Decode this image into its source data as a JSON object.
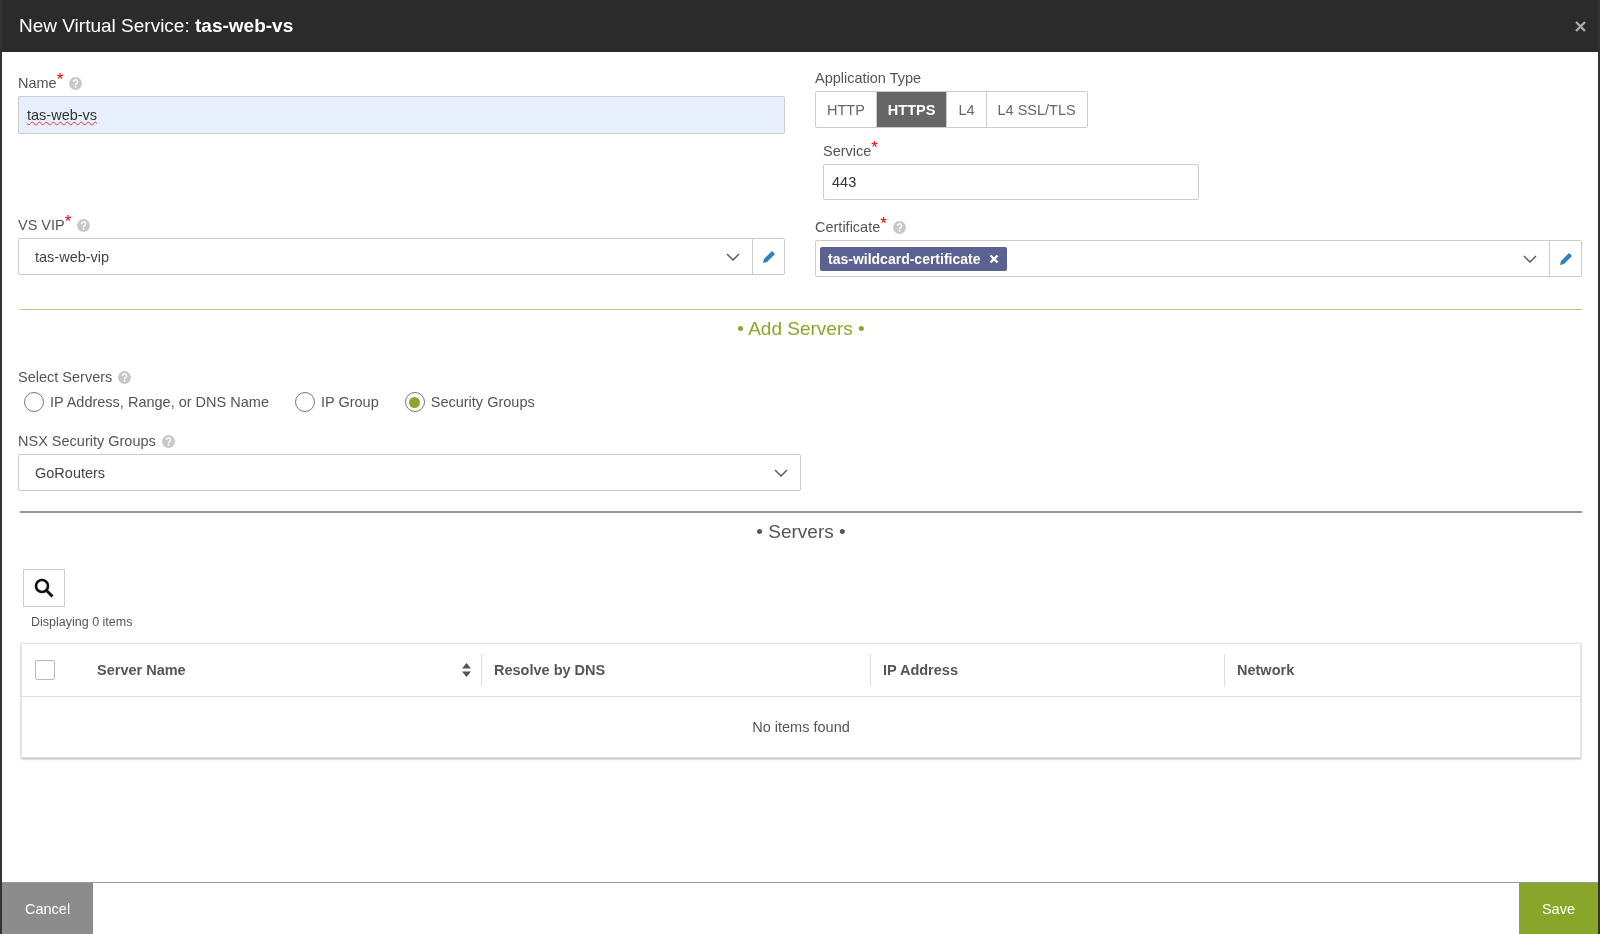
{
  "window": {
    "title": "New Virtual Service: **tas-web-vs**"
  },
  "name_field": {
    "label": "Name",
    "required_mark": "*",
    "help": true,
    "value": "tas-web-vs"
  },
  "application_type": {
    "label": "Application Type",
    "options": [
      {
        "label": "HTTP",
        "selected": false
      },
      {
        "label": "HTTPS",
        "selected": true
      },
      {
        "label": "L4",
        "selected": false
      },
      {
        "label": "L4 SSL/TLS",
        "selected": false
      }
    ]
  },
  "service": {
    "label": "Service",
    "required_mark": "*",
    "help": false,
    "value": "443"
  },
  "vs_vip": {
    "label": "VS VIP",
    "required_mark": "*",
    "help": true,
    "value": "tas-web-vip"
  },
  "certificate": {
    "label": "Certificate",
    "required_mark": "*",
    "help": true,
    "tags": [
      "tas-wildcard-certificate"
    ]
  },
  "add_servers_heading": "• Add Servers •",
  "select_servers": {
    "label": "Select Servers",
    "help": true,
    "options": [
      {
        "label": "IP Address, Range, or DNS Name",
        "selected": false
      },
      {
        "label": "IP Group",
        "selected": false
      },
      {
        "label": "Security Groups",
        "selected": true
      }
    ]
  },
  "nsx_security_groups": {
    "label": "NSX Security Groups",
    "help": true,
    "value": "GoRouters"
  },
  "servers_heading": "• Servers •",
  "servers_table": {
    "summary": "Displaying 0 items",
    "select_all_checked": false,
    "columns": [
      {
        "label": "Server Name",
        "sortable": true
      },
      {
        "label": "Resolve by DNS",
        "sortable": false
      },
      {
        "label": "IP Address",
        "sortable": false
      },
      {
        "label": "Network",
        "sortable": false
      }
    ],
    "empty_message": "No items found"
  },
  "footer": {
    "cancel": "Cancel",
    "save": "Save"
  }
}
